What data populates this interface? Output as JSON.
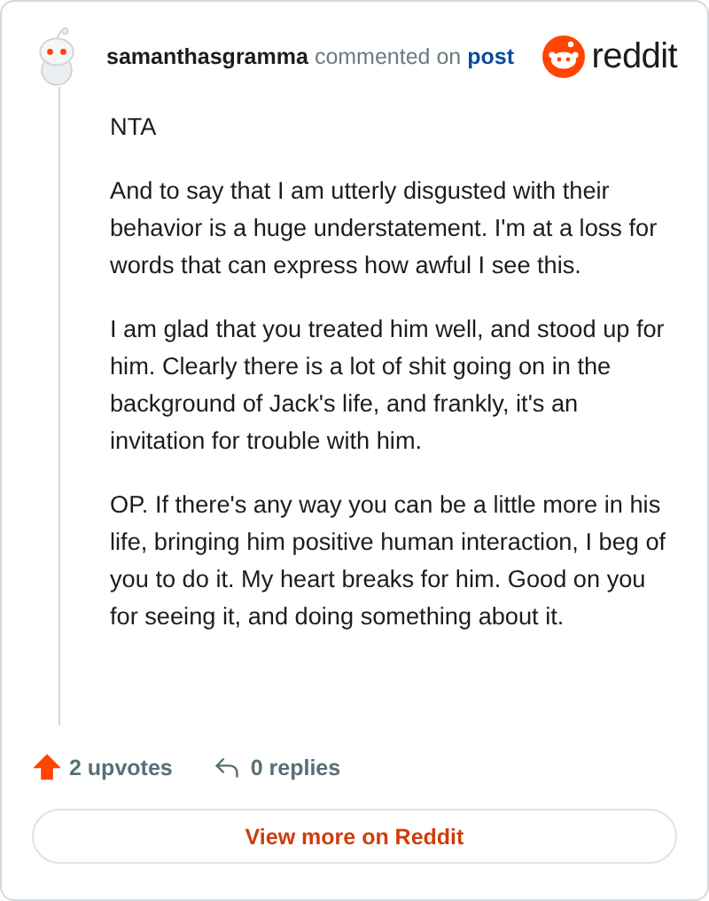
{
  "comment": {
    "author": "samanthasgramma",
    "action": "commented on",
    "link": "post"
  },
  "brand": {
    "name": "reddit"
  },
  "paragraphs": [
    "NTA",
    "And to say that I am utterly disgusted with their behavior is a huge understatement. I'm at a loss for words that can express how awful I see this.",
    "I am glad that you treated him well, and stood up for him. Clearly there is a lot of shit going on in the background of Jack's life, and frankly, it's an invitation for trouble with him.",
    "OP. If there's any way you can be a little more in his life, bringing him positive human interaction, I beg of you to do it. My heart breaks for him. Good on you for seeing it, and doing something about it."
  ],
  "stats": {
    "upvotes": "2 upvotes",
    "upvoted": true,
    "replies": "0 replies"
  },
  "button": "View more on Reddit"
}
